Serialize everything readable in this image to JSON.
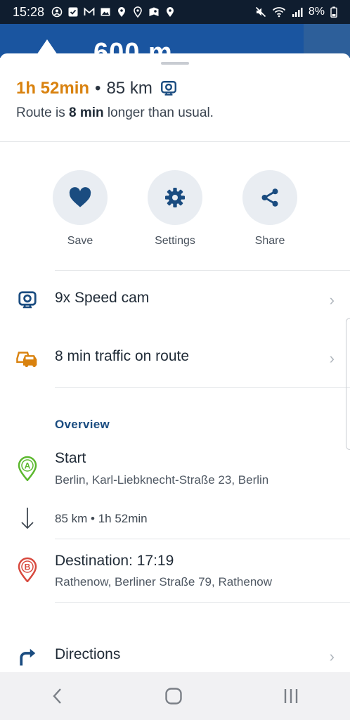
{
  "status_bar": {
    "time": "15:28",
    "battery": "8%",
    "icons": [
      "whatsapp-icon",
      "check-square-icon",
      "gmail-icon",
      "image-icon",
      "location-icon",
      "location-outline-icon",
      "maps-icon",
      "location-icon"
    ]
  },
  "maneuver": {
    "distance": "600 m"
  },
  "route_summary": {
    "duration": "1h 52min",
    "separator": "•",
    "distance": "85 km",
    "note_prefix": "Route is ",
    "note_bold": "8 min",
    "note_suffix": " longer than usual."
  },
  "actions": [
    {
      "label": "Save",
      "icon": "heart-icon"
    },
    {
      "label": "Settings",
      "icon": "gear-icon"
    },
    {
      "label": "Share",
      "icon": "share-icon"
    }
  ],
  "info_rows": {
    "speed_cam": "9x Speed cam",
    "traffic": "8 min traffic on route"
  },
  "overview": {
    "heading": "Overview",
    "start_title": "Start",
    "start_address": "Berlin, Karl-Liebknecht-Straße 23, Berlin",
    "start_marker": "A",
    "leg": "85 km • 1h 52min",
    "destination_title": "Destination: 17:19",
    "destination_address": "Rathenow, Berliner Straße 79, Rathenow",
    "destination_marker": "B"
  },
  "directions": {
    "label": "Directions"
  },
  "colors": {
    "accent_orange": "#d9820f",
    "brand_blue": "#1a4c80",
    "start_green": "#5cb82e",
    "dest_red": "#d84a3f"
  }
}
